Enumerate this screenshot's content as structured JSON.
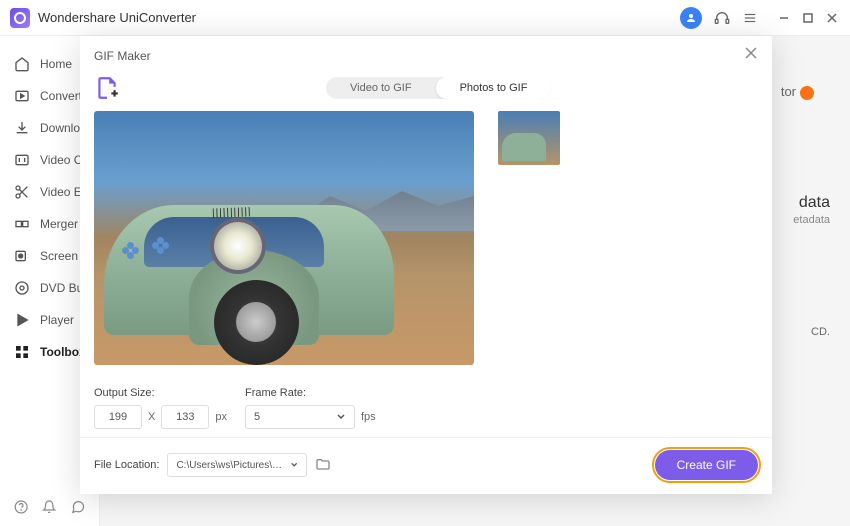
{
  "app": {
    "title": "Wondershare UniConverter"
  },
  "sidebar": {
    "items": [
      {
        "label": "Home"
      },
      {
        "label": "Converter"
      },
      {
        "label": "Downloader"
      },
      {
        "label": "Video Compressor"
      },
      {
        "label": "Video Editor"
      },
      {
        "label": "Merger"
      },
      {
        "label": "Screen Recorder"
      },
      {
        "label": "DVD Burner"
      },
      {
        "label": "Player"
      },
      {
        "label": "Toolbox"
      }
    ]
  },
  "background": {
    "label1": "tor",
    "label2": "data",
    "label3": "etadata",
    "label4": "CD."
  },
  "modal": {
    "title": "GIF Maker",
    "tabs": {
      "video": "Video to GIF",
      "photos": "Photos to GIF"
    },
    "output_size": {
      "label": "Output Size:",
      "width": "199",
      "height": "133",
      "sep": "X",
      "unit": "px"
    },
    "frame_rate": {
      "label": "Frame Rate:",
      "value": "5",
      "unit": "fps"
    },
    "file_location": {
      "label": "File Location:",
      "path": "C:\\Users\\ws\\Pictures\\Wonders"
    },
    "create_button": "Create GIF"
  }
}
